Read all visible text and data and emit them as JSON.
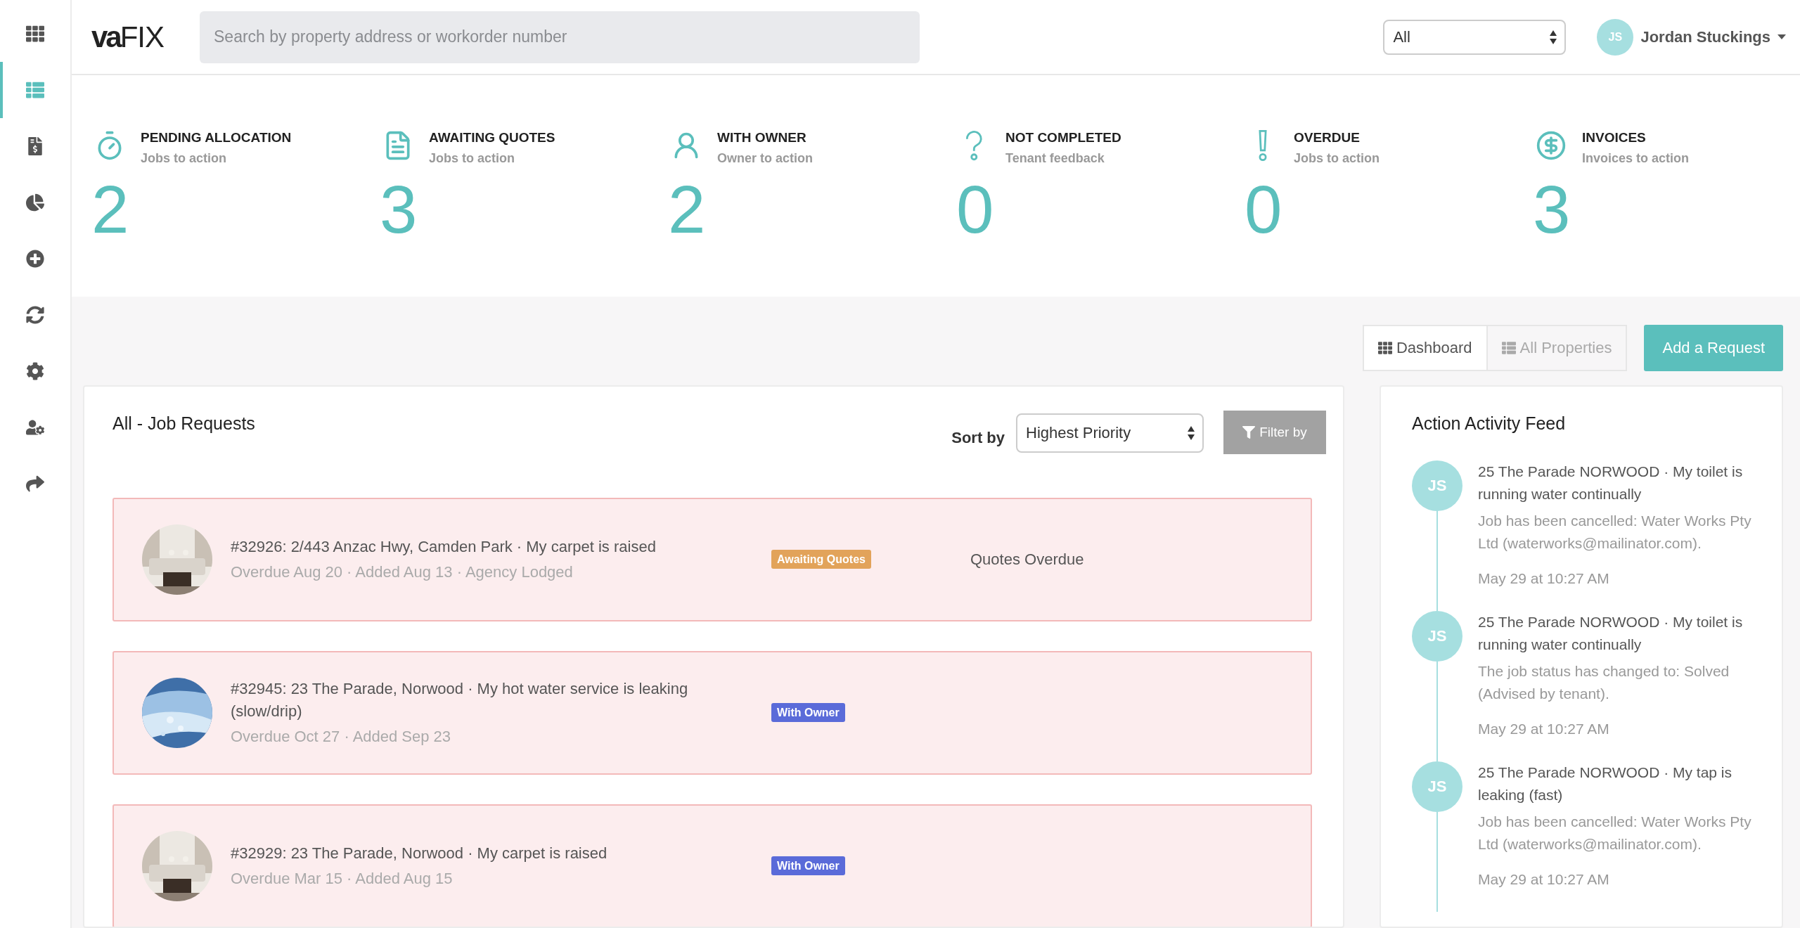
{
  "sidebar": {
    "items": [
      {
        "selected": false
      },
      {
        "selected": true
      },
      {
        "selected": false
      },
      {
        "selected": false
      },
      {
        "selected": false
      },
      {
        "selected": false
      },
      {
        "selected": false
      },
      {
        "selected": false
      },
      {
        "selected": false
      }
    ]
  },
  "header": {
    "logo": "**va**FIX",
    "search": {
      "placeholder": "Search by property address or workorder number"
    },
    "filter_select": {
      "value": "All"
    },
    "user": {
      "initials": "JS",
      "name": "Jordan Stuckings"
    }
  },
  "stats": [
    {
      "title": "PENDING ALLOCATION",
      "subtitle": "Jobs to action",
      "count": "2"
    },
    {
      "title": "AWAITING QUOTES",
      "subtitle": "Jobs to action",
      "count": "3"
    },
    {
      "title": "WITH OWNER",
      "subtitle": "Owner to action",
      "count": "2"
    },
    {
      "title": "NOT COMPLETED",
      "subtitle": "Tenant feedback",
      "count": "0"
    },
    {
      "title": "OVERDUE",
      "subtitle": "Jobs to action",
      "count": "0"
    },
    {
      "title": "INVOICES",
      "subtitle": "Invoices to action",
      "count": "3"
    }
  ],
  "view_tabs": [
    {
      "label": "Dashboard",
      "selected": true
    },
    {
      "label": "All Properties",
      "selected": false
    }
  ],
  "add_button": "Add a Request",
  "jobs_panel": {
    "title": "All - Job Requests",
    "sort_label": "Sort by",
    "sort_value": "Highest Priority",
    "filter_button": "Filter by",
    "rows": [
      {
        "title": "#32926: 2/443 Anzac Hwy, Camden Park · My carpet is raised",
        "meta": "Overdue Aug 20 · Added Aug 13 · Agency Lodged",
        "overdue": true,
        "status": {
          "label": "Awaiting Quotes",
          "kind": "awaiting"
        },
        "note": "Quotes Overdue"
      },
      {
        "title": "#32945: 23 The Parade, Norwood · My hot water service is leaking (slow/drip)",
        "meta": "Overdue Oct 27 · Added Sep 23",
        "overdue": true,
        "status": {
          "label": "With Owner",
          "kind": "owner"
        }
      },
      {
        "title": "#32929: 23 The Parade, Norwood · My carpet is raised",
        "meta": "Overdue Mar 15 · Added Aug 15",
        "overdue": true,
        "status": {
          "label": "With Owner",
          "kind": "owner"
        }
      }
    ]
  },
  "feed": {
    "title": "Action Activity Feed",
    "items": [
      {
        "initials": "JS",
        "title": "25 The Parade NORWOOD · My toilet is running water continually",
        "body": "Job has been cancelled: Water Works Pty Ltd (waterworks@mailinator.com).",
        "time": "May 29 at 10:27 AM"
      },
      {
        "initials": "JS",
        "title": "25 The Parade NORWOOD · My toilet is running water continually",
        "body": "The job status has changed to: Solved (Advised by tenant).",
        "time": "May 29 at 10:27 AM"
      },
      {
        "initials": "JS",
        "title": "25 The Parade NORWOOD · My tap is leaking (fast)",
        "body": "Job has been cancelled: Water Works Pty Ltd (waterworks@mailinator.com).",
        "time": "May 29 at 10:27 AM"
      }
    ]
  }
}
